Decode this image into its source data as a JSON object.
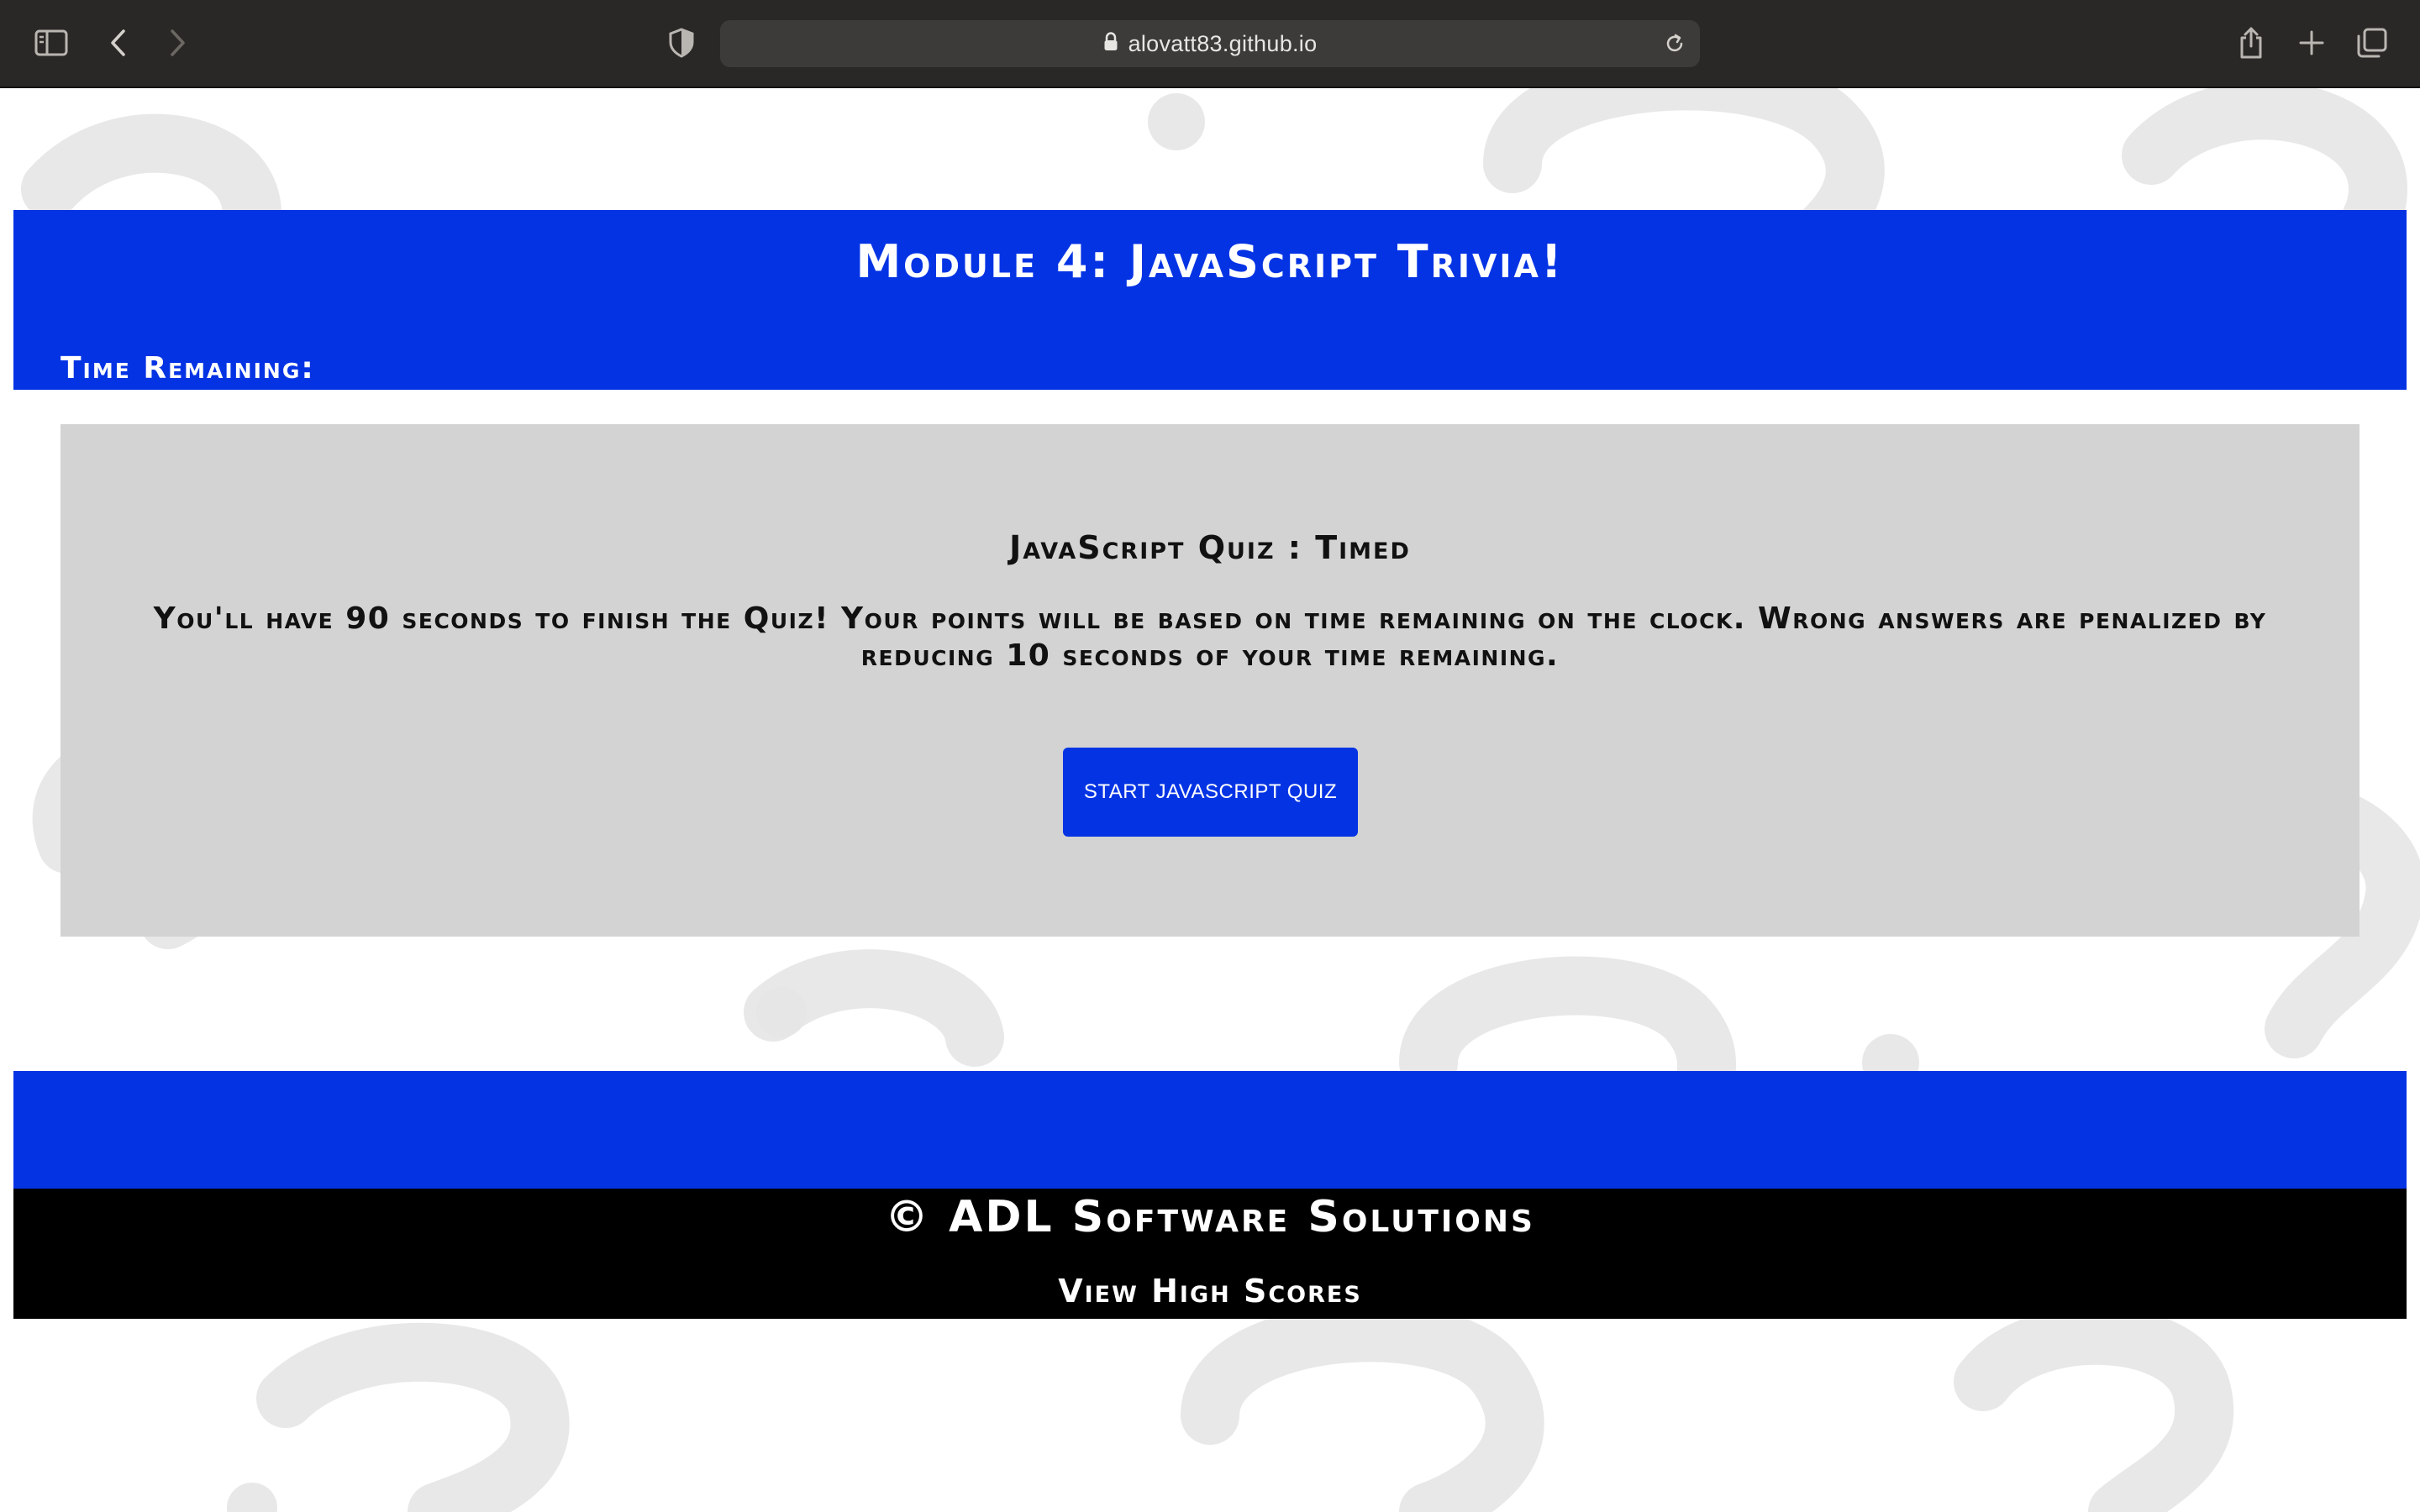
{
  "browser": {
    "url": "alovatt83.github.io",
    "icons": {
      "sidebar": "sidebar-icon",
      "back": "chevron-left-icon",
      "forward": "chevron-right-icon",
      "privacy": "shield-icon",
      "lock": "lock-icon",
      "reload": "reload-icon",
      "share": "share-icon",
      "new_tab": "plus-icon",
      "tabs": "tabs-overview-icon"
    }
  },
  "header": {
    "title": "Module 4: JavaScript Trivia!",
    "timer_label": "Time Remaining:"
  },
  "quiz": {
    "title": "JavaScript Quiz : Timed",
    "description": "You'll have 90 seconds to finish the Quiz! Your points will be based on time remaining on the clock. Wrong answers are penalized by reducing 10 seconds of your time remaining.",
    "start_button": "START JAVASCRIPT QUIZ"
  },
  "footer": {
    "copyright": "© ADL Software Solutions",
    "high_scores_link": "View High Scores"
  },
  "colors": {
    "brand_blue": "#0433e4",
    "card_gray": "#d3d3d3",
    "footer_black": "#000000",
    "chrome_dark": "#2a2826"
  }
}
